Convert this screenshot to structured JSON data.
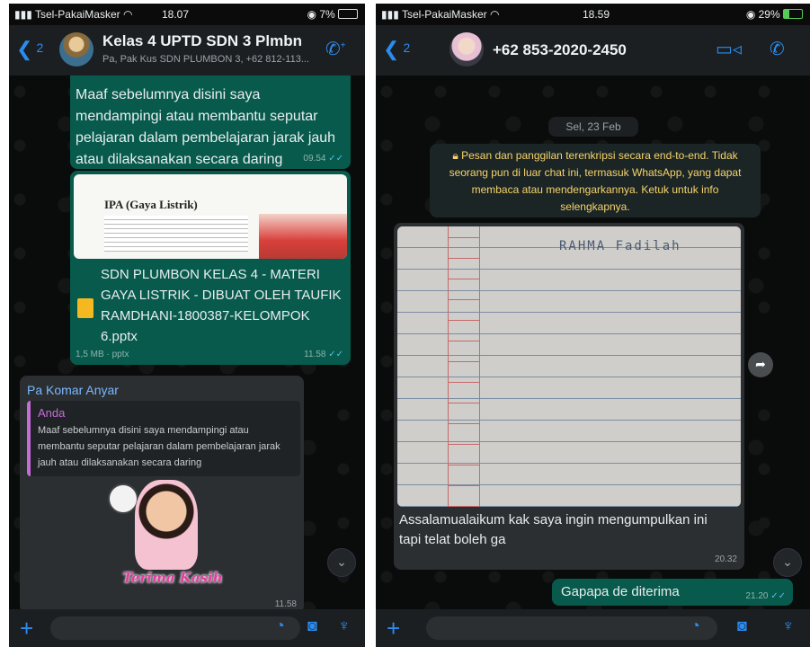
{
  "left": {
    "status": {
      "carrier": "Tsel-PakaiMasker",
      "time": "18.07",
      "battery": "7%"
    },
    "header": {
      "back_count": "2",
      "title": "Kelas 4 UPTD SDN 3 Plmbn",
      "subtitle": "Pa, Pak Kus SDN PLUMBON 3, +62 812-113..."
    },
    "messages": {
      "text1": "Maaf sebelumnya disini saya mendampingi atau membantu seputar pelajaran dalam pembelajaran jarak jauh atau dilaksanakan secara daring",
      "time1": "09.54",
      "doc_preview_title": "IPA (Gaya Listrik)",
      "doc_filename": "SDN PLUMBON KELAS 4 - MATERI GAYA LISTRIK - DIBUAT OLEH TAUFIK RAMDHANI-1800387-KELOMPOK 6.pptx",
      "doc_meta": "1,5 MB · pptx",
      "time2": "11.58",
      "reply_sender": "Pa Komar Anyar",
      "quote_sender": "Anda",
      "quote_text": "Maaf sebelumnya disini saya mendampingi atau membantu seputar pelajaran dalam pembelajaran jarak jauh atau dilaksanakan secara daring",
      "sticker_text": "Terima Kasih",
      "time3": "11.58"
    }
  },
  "right": {
    "status": {
      "carrier": "Tsel-PakaiMasker",
      "time": "18.59",
      "battery": "29%"
    },
    "header": {
      "back_count": "2",
      "title": "+62 853-2020-2450"
    },
    "messages": {
      "date_chip": "Sel, 23 Feb",
      "encryption_notice": "Pesan dan panggilan terenkripsi secara end-to-end. Tidak seorang pun di luar chat ini, termasuk WhatsApp, yang dapat membaca atau mendengarkannya. Ketuk untuk info selengkapnya.",
      "photo_handwriting": "RAHMA Fadilah",
      "photo_caption": "Assalamualaikum kak saya ingin mengumpulkan ini tapi telat boleh ga",
      "time1": "20.32",
      "reply_text": "Gapapa de diterima",
      "time2": "21.20"
    }
  },
  "icons": {
    "signal": "signal-icon",
    "wifi": "wifi-icon",
    "battery": "battery-icon",
    "back": "chevron-left-icon",
    "add_participant_call": "phone-plus-icon",
    "video": "video-icon",
    "phone": "phone-icon",
    "lock": "lock-icon",
    "document": "document-icon",
    "forward": "forward-icon",
    "scroll_down": "chevron-down-icon",
    "attach": "plus-icon",
    "sticker": "sticker-icon",
    "camera": "camera-icon",
    "mic": "mic-icon"
  },
  "colors": {
    "accent": "#2a8cf0",
    "outgoing": "#075a4c",
    "incoming": "#2b2f32",
    "header": "#1b1f21",
    "notice": "#1f2a2a"
  }
}
